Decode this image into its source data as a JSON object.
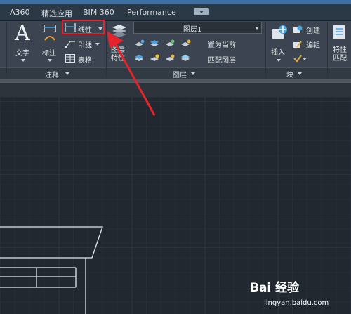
{
  "tabs": [
    "A360",
    "精选应用",
    "BIM 360",
    "Performance"
  ],
  "annotation_panel": {
    "text_label": "文字",
    "dimension_label": "标注",
    "linear_label": "线性",
    "leader_label": "引线",
    "table_label": "表格",
    "title": "注释"
  },
  "layers_panel": {
    "properties_label": "图层\n特性",
    "current_layer": "图层1",
    "set_current_label": "置为当前",
    "match_layer_label": "匹配图层",
    "title": "图层"
  },
  "block_panel": {
    "insert_label": "插入",
    "create_label": "创建",
    "edit_label": "编辑",
    "title": "块"
  },
  "properties_panel": {
    "label": "特性\n匹配"
  },
  "watermark": {
    "brand": "Bai 经验",
    "url": "jingyan.baidu.com"
  },
  "colors": {
    "accent_red": "#e5232b",
    "canvas_bg": "#212830",
    "ribbon_bg": "#3b4450"
  }
}
